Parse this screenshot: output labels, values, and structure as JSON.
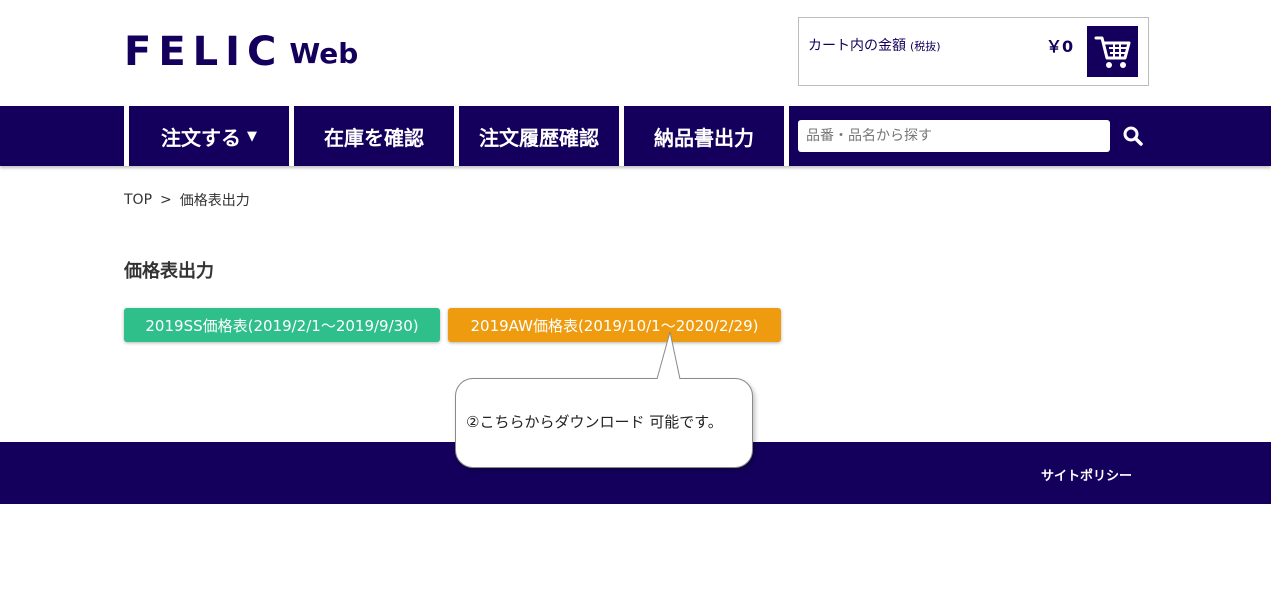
{
  "header": {
    "logo_main": "FELIC",
    "logo_sub": "Web",
    "cart_label": "カート内の金額",
    "cart_label_small": "(税抜)",
    "cart_amount": "￥0",
    "cart_icon": "shopping-cart-icon"
  },
  "nav": {
    "items": [
      {
        "label": "注文する",
        "caret": "▼"
      },
      {
        "label": "在庫を確認"
      },
      {
        "label": "注文履歴確認"
      },
      {
        "label": "納品書出力"
      }
    ],
    "search_placeholder": "品番・品名から探す",
    "search_icon": "search-icon"
  },
  "breadcrumb": {
    "home": "TOP",
    "separator": ">",
    "current": "価格表出力"
  },
  "main": {
    "title": "価格表出力",
    "buttons": [
      {
        "label": "2019SS価格表(2019/2/1～2019/9/30)",
        "color": "#2fbf8b"
      },
      {
        "label": "2019AW価格表(2019/10/1～2020/2/29)",
        "color": "#ef9b0f"
      }
    ]
  },
  "callout": {
    "text": "②こちらからダウンロード 可能です。"
  },
  "footer": {
    "link": "サイトポリシー"
  },
  "colors": {
    "brand": "#14005c",
    "green": "#2fbf8b",
    "orange": "#ef9b0f"
  }
}
